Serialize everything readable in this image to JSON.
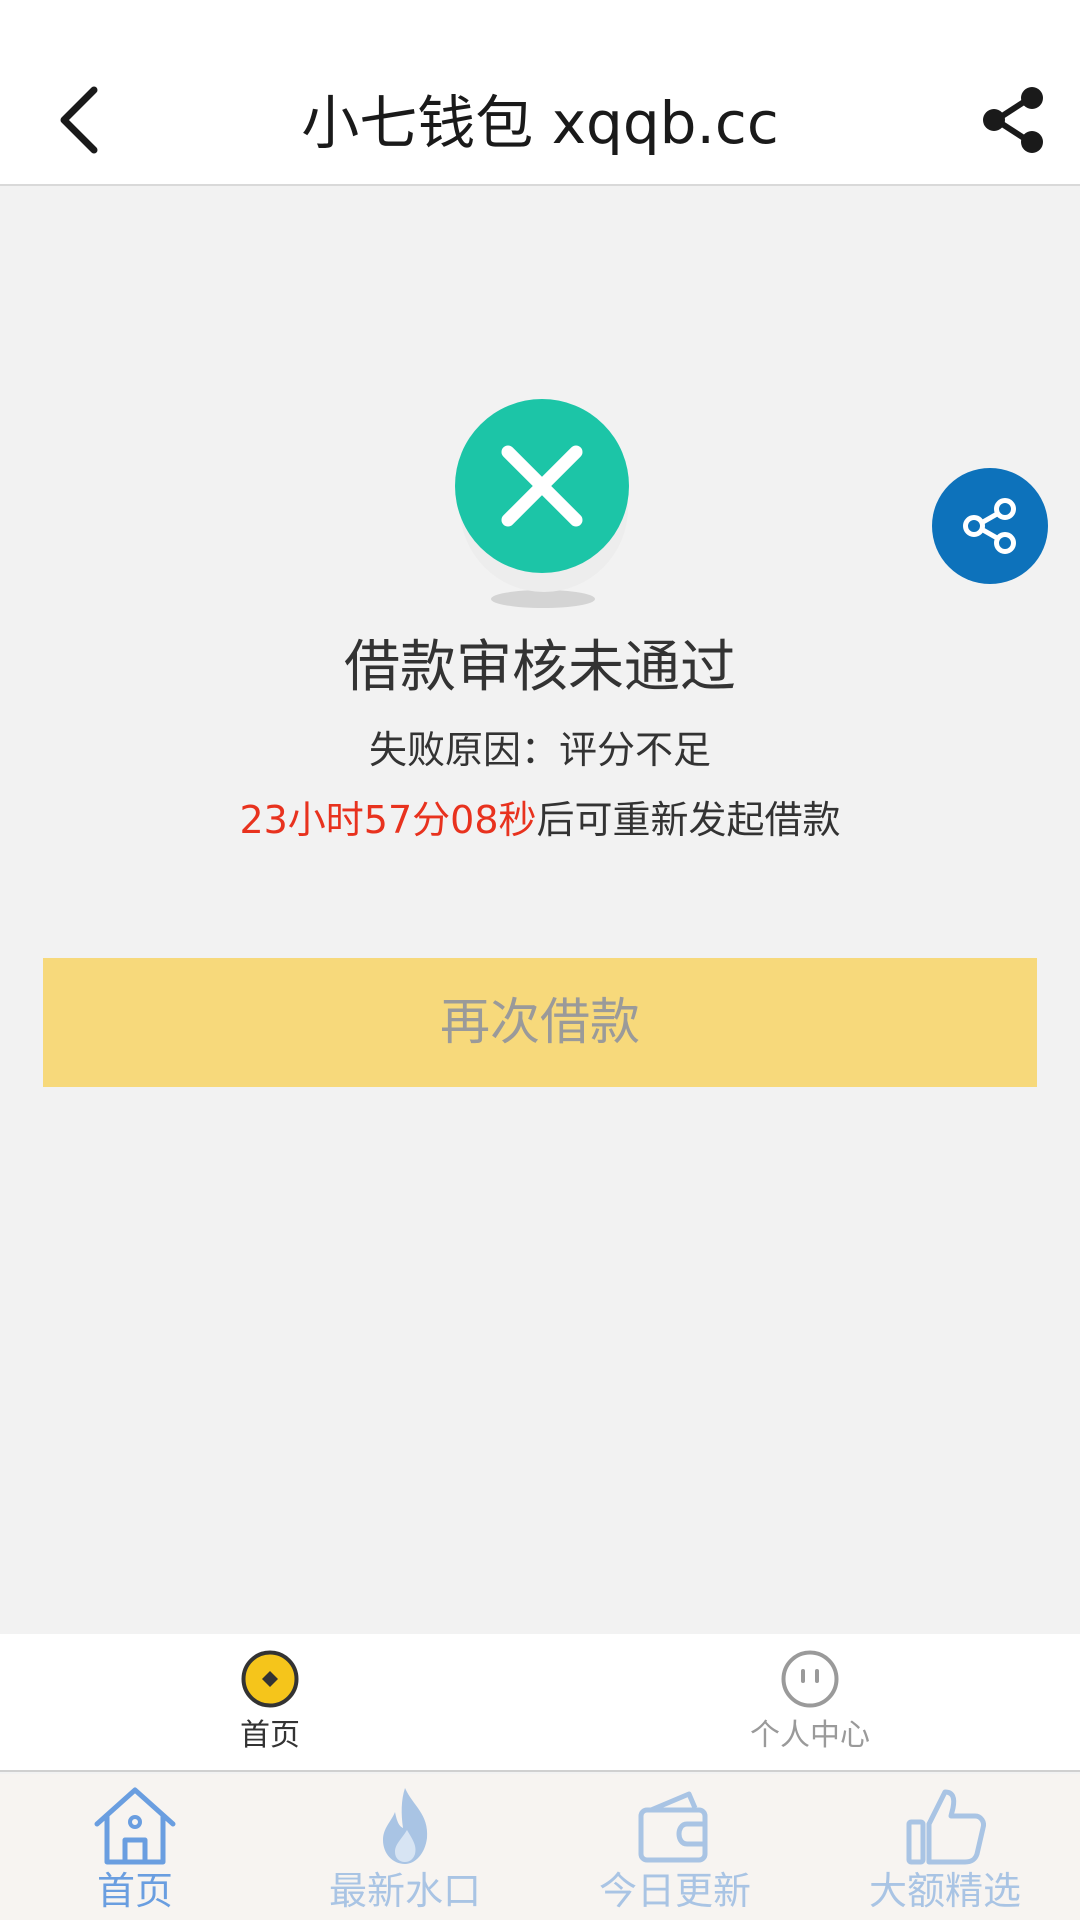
{
  "header": {
    "title": "小七钱包 xqqb.cc",
    "back_icon": "chevron-left-icon",
    "share_icon": "share-icon"
  },
  "result": {
    "status_icon": "close-circle-icon",
    "title": "借款审核未通过",
    "reason": "失败原因：评分不足",
    "countdown": "23小时57分08秒",
    "countdown_suffix": "后可重新发起借款"
  },
  "retry_button": {
    "label": "再次借款"
  },
  "inner_tabs": [
    {
      "label": "首页",
      "icon": "coin-icon",
      "active": true
    },
    {
      "label": "个人中心",
      "icon": "face-icon",
      "active": false
    }
  ],
  "outer_tabs": [
    {
      "label": "首页",
      "icon": "home-icon",
      "active": true
    },
    {
      "label": "最新水口",
      "icon": "flame-icon",
      "active": false
    },
    {
      "label": "今日更新",
      "icon": "wallet-icon",
      "active": false
    },
    {
      "label": "大额精选",
      "icon": "thumbs-up-icon",
      "active": false
    }
  ],
  "colors": {
    "accent_teal": "#1cc5a7",
    "share_blue": "#0d72bb",
    "button_yellow": "#f7d97b",
    "countdown_red": "#e8321e",
    "coin_yellow": "#f5c51b",
    "tab_active_blue": "#6a9ee0",
    "tab_inactive_blue": "#a9c4e4"
  }
}
